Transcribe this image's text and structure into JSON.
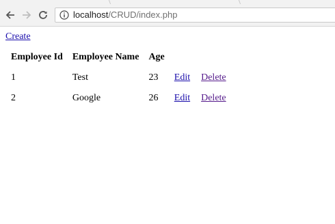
{
  "browser": {
    "url_host": "localhost",
    "url_path": "/CRUD/index.php"
  },
  "page": {
    "create_link": "Create",
    "table": {
      "headers": [
        "Employee Id",
        "Employee Name",
        "Age"
      ],
      "rows": [
        {
          "id": "1",
          "name": "Test",
          "age": "23",
          "edit": "Edit",
          "delete": "Delete"
        },
        {
          "id": "2",
          "name": "Google",
          "age": "26",
          "edit": "Edit",
          "delete": "Delete"
        }
      ]
    }
  },
  "colors": {
    "link": "#1a0dab",
    "visited_link": "#551a8b"
  },
  "icons": [
    "back-arrow-icon",
    "forward-arrow-icon",
    "reload-icon",
    "info-icon"
  ]
}
